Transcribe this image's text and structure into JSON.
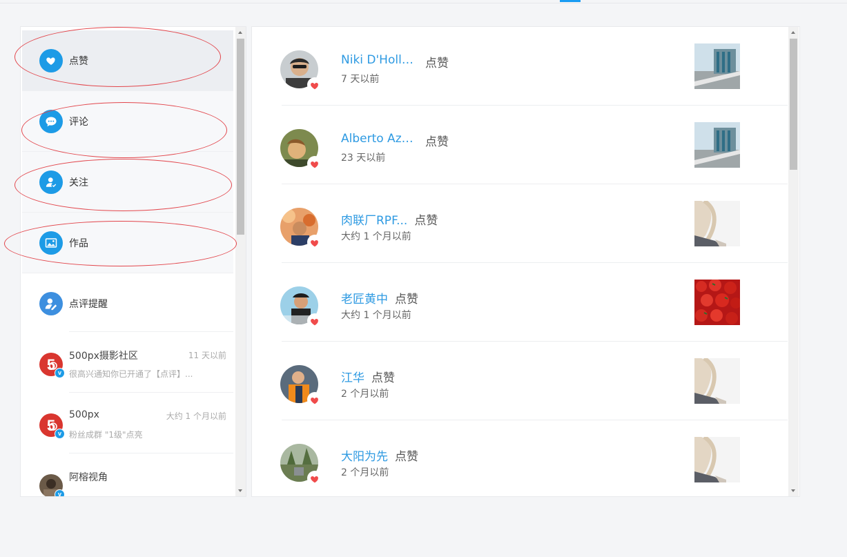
{
  "categories": [
    {
      "label": "点赞",
      "icon": "heart-icon",
      "active": true
    },
    {
      "label": "评论",
      "icon": "comment-icon",
      "active": false
    },
    {
      "label": "关注",
      "icon": "follow-user-icon",
      "active": false
    },
    {
      "label": "作品",
      "icon": "image-icon",
      "active": false
    }
  ],
  "remind": {
    "label": "点评提醒",
    "icon": "reviewer-icon"
  },
  "messages": [
    {
      "name": "500px摄影社区",
      "time": "11 天以前",
      "snippet": "很高兴通知你已开通了【点评】..."
    },
    {
      "name": "500px",
      "time": "大约 1 个月以前",
      "snippet": "粉丝成群 \"1级\"点亮"
    },
    {
      "name": "阿榕视角",
      "time": "",
      "snippet": ""
    }
  ],
  "notifications": [
    {
      "name": "Niki D'Holla...",
      "action": "点赞",
      "time": "7 天以前"
    },
    {
      "name": "Alberto Aznar",
      "action": "点赞",
      "time": "23 天以前"
    },
    {
      "name": "肉联厂RPF...",
      "action": "点赞",
      "time": "大约 1 个月以前"
    },
    {
      "name": "老匠黄中",
      "action": "点赞",
      "time": "大约 1 个月以前"
    },
    {
      "name": "江华",
      "action": "点赞",
      "time": "2 个月以前"
    },
    {
      "name": "大阳为先",
      "action": "点赞",
      "time": "2 个月以前"
    }
  ],
  "colors": {
    "accent": "#1d9be6",
    "link": "#2e9ae2",
    "heart": "#f04b4b",
    "annotation": "#e2454b"
  }
}
